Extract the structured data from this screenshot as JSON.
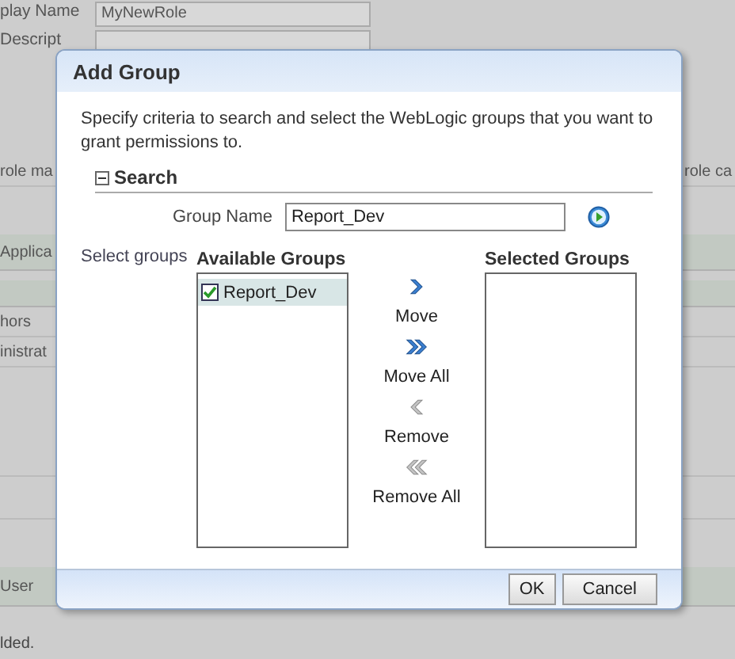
{
  "background": {
    "fields": [
      {
        "label": "play Name",
        "value": "MyNewRole"
      },
      {
        "label": "Descript"
      }
    ],
    "texts_left": [
      "role ma",
      "Applica",
      "hors",
      "inistrat",
      "User",
      "lded."
    ],
    "texts_right": [
      "role ca"
    ]
  },
  "dialog": {
    "title": "Add Group",
    "instructions": "Specify criteria to search and select the WebLogic groups that you want to grant permissions to.",
    "search": {
      "title": "Search",
      "expanded": true,
      "field_label": "Group Name",
      "value": "Report_Dev"
    },
    "select_label": "Select groups",
    "available": {
      "title": "Available Groups",
      "items": [
        {
          "label": "Report_Dev",
          "checked": true,
          "selected": true
        }
      ]
    },
    "selected": {
      "title": "Selected Groups"
    },
    "shuttle": [
      {
        "kind": "move",
        "label": "Move",
        "disabled": false
      },
      {
        "kind": "move_all",
        "label": "Move All",
        "disabled": false
      },
      {
        "kind": "remove",
        "label": "Remove",
        "disabled": true
      },
      {
        "kind": "remove_all",
        "label": "Remove All",
        "disabled": true
      }
    ],
    "buttons": [
      "OK",
      "Cancel"
    ]
  }
}
